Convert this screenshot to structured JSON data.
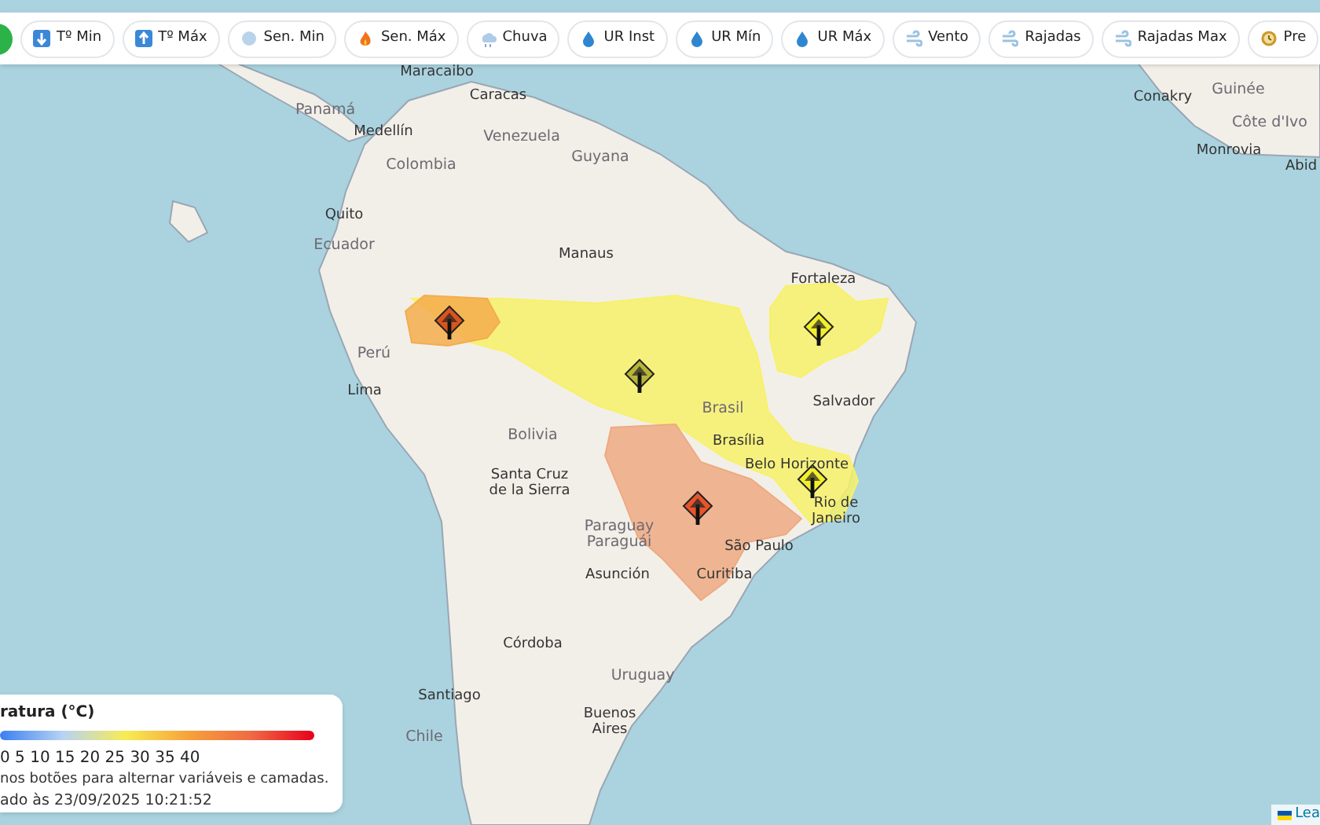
{
  "toolbar": {
    "buttons": [
      {
        "kind": "dot"
      },
      {
        "kind": "temp-down",
        "label": "Tº Min"
      },
      {
        "kind": "temp-up",
        "label": "Tº Máx"
      },
      {
        "kind": "snow",
        "label": "Sen. Min"
      },
      {
        "kind": "fire",
        "label": "Sen. Máx"
      },
      {
        "kind": "rain",
        "label": "Chuva"
      },
      {
        "kind": "drop",
        "label": "UR Inst"
      },
      {
        "kind": "drop",
        "label": "UR Mín"
      },
      {
        "kind": "drop",
        "label": "UR Máx"
      },
      {
        "kind": "wind",
        "label": "Vento"
      },
      {
        "kind": "wind",
        "label": "Rajadas"
      },
      {
        "kind": "wind",
        "label": "Rajadas Max"
      },
      {
        "kind": "clock",
        "label": "Pre"
      }
    ]
  },
  "map": {
    "labels": [
      {
        "text": "Maracaibo",
        "kind": "city"
      },
      {
        "text": "Panamá",
        "kind": "country"
      },
      {
        "text": "Caracas",
        "kind": "city"
      },
      {
        "text": "Medellín",
        "kind": "city"
      },
      {
        "text": "Venezuela",
        "kind": "country"
      },
      {
        "text": "Guyana",
        "kind": "country"
      },
      {
        "text": "Colombia",
        "kind": "country"
      },
      {
        "text": "Quito",
        "kind": "city"
      },
      {
        "text": "Ecuador",
        "kind": "country"
      },
      {
        "text": "Manaus",
        "kind": "city"
      },
      {
        "text": "Fortaleza",
        "kind": "city"
      },
      {
        "text": "Perú",
        "kind": "country"
      },
      {
        "text": "Lima",
        "kind": "city"
      },
      {
        "text": "Salvador",
        "kind": "city"
      },
      {
        "text": "Brasil",
        "kind": "country"
      },
      {
        "text": "Bolivia",
        "kind": "country"
      },
      {
        "text": "Brasília",
        "kind": "city"
      },
      {
        "text": "Santa Cruz de la Sierra",
        "kind": "city"
      },
      {
        "text": "Belo Horizonte",
        "kind": "city"
      },
      {
        "text": "Paraguay",
        "kind": "country"
      },
      {
        "text": "Rio de Janeiro",
        "kind": "city"
      },
      {
        "text": "Paraguái",
        "kind": "country"
      },
      {
        "text": "São Paulo",
        "kind": "city"
      },
      {
        "text": "Asunción",
        "kind": "city"
      },
      {
        "text": "Curitiba",
        "kind": "city"
      },
      {
        "text": "Córdoba",
        "kind": "city"
      },
      {
        "text": "Uruguay",
        "kind": "country"
      },
      {
        "text": "Buenos Aires",
        "kind": "city"
      },
      {
        "text": "Santiago",
        "kind": "city"
      },
      {
        "text": "Chile",
        "kind": "country"
      },
      {
        "text": "Conakry",
        "kind": "city"
      },
      {
        "text": "Guinée",
        "kind": "country"
      },
      {
        "text": "Côte d'Ivo",
        "kind": "country"
      },
      {
        "text": "Monrovia",
        "kind": "city"
      },
      {
        "text": "Abid",
        "kind": "city"
      }
    ],
    "alert_areas": [
      {
        "color": "#f7f16a"
      },
      {
        "color": "#f4ad4c"
      },
      {
        "color": "#f7f16a"
      },
      {
        "color": "#eeaa82"
      }
    ],
    "alert_markers": [
      {
        "color": "#d9541e"
      },
      {
        "color": "#b8b43a"
      },
      {
        "color": "#f2ee2e"
      },
      {
        "color": "#f2ee2e"
      },
      {
        "color": "#e8542a"
      }
    ]
  },
  "legend": {
    "title": "ratura (°C)",
    "scale": "0 5 10 15 20 25 30 35 40",
    "hint": "nos botões para alternar variáveis e camadas.",
    "updated": "ado às 23/09/2025 10:21:52"
  },
  "attribution": "Lea"
}
